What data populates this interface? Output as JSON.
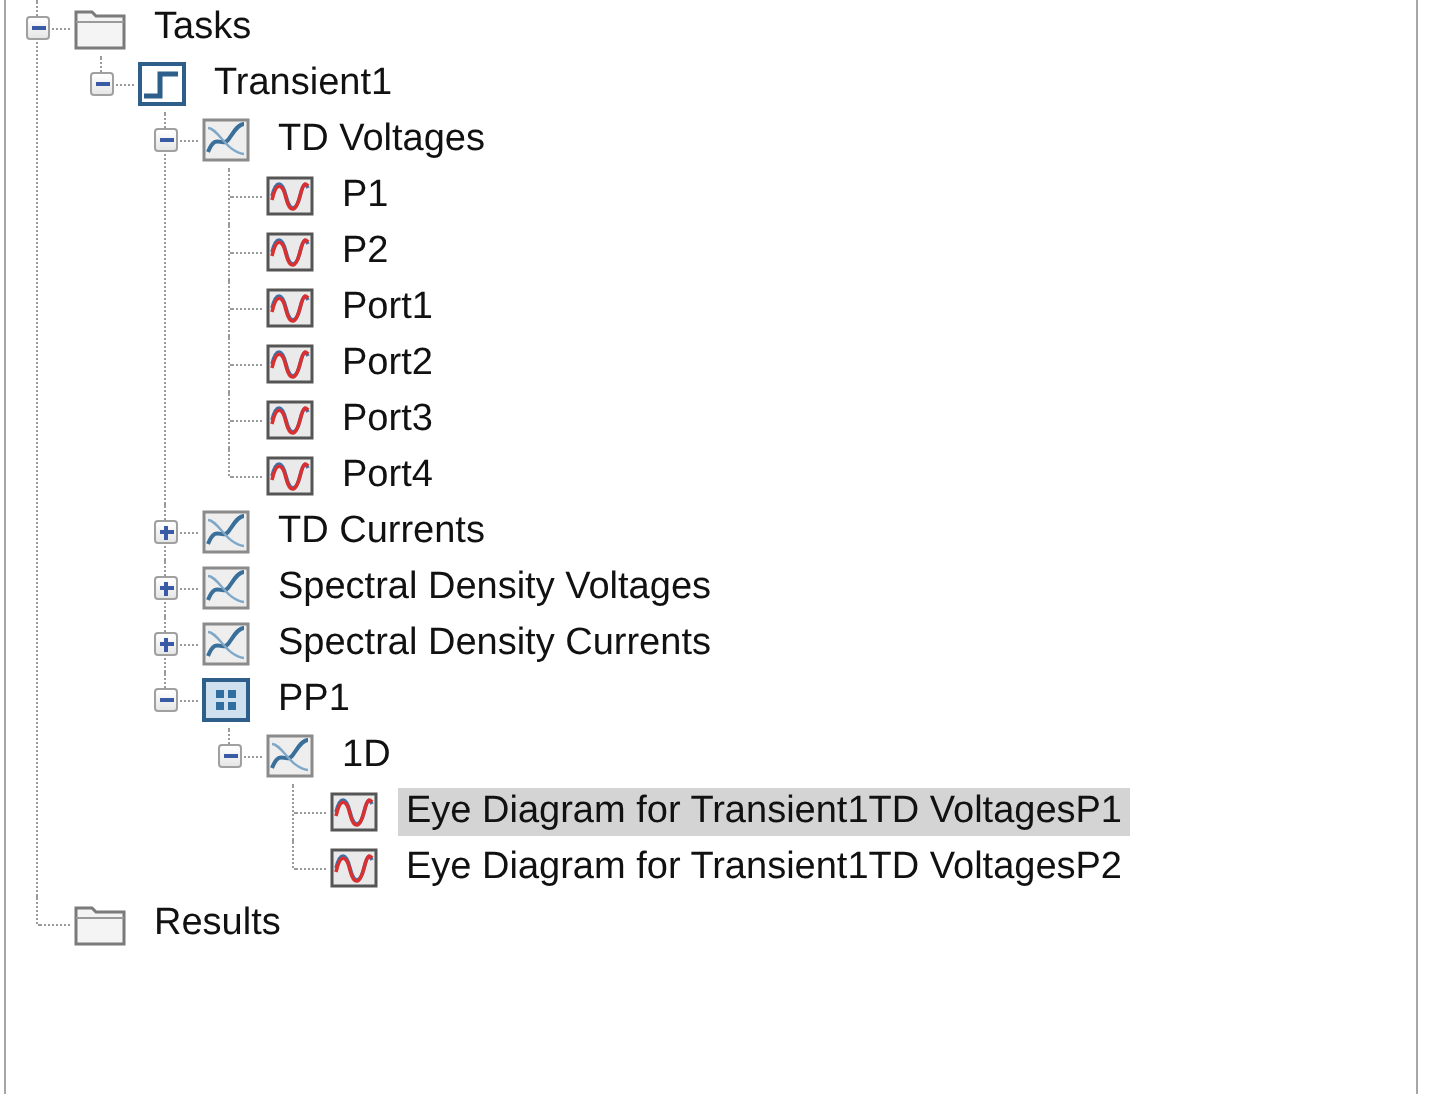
{
  "tree": [
    {
      "label": "Tasks",
      "kind": "folder",
      "expanded": true,
      "selected": false,
      "children": [
        {
          "label": "Transient1",
          "kind": "task",
          "expanded": true,
          "selected": false,
          "children": [
            {
              "label": "TD Voltages",
              "kind": "result-group",
              "expanded": true,
              "selected": false,
              "children": [
                {
                  "label": "P1",
                  "kind": "result",
                  "selected": false
                },
                {
                  "label": "P2",
                  "kind": "result",
                  "selected": false
                },
                {
                  "label": "Port1",
                  "kind": "result",
                  "selected": false
                },
                {
                  "label": "Port2",
                  "kind": "result",
                  "selected": false
                },
                {
                  "label": "Port3",
                  "kind": "result",
                  "selected": false
                },
                {
                  "label": "Port4",
                  "kind": "result",
                  "selected": false
                }
              ]
            },
            {
              "label": "TD Currents",
              "kind": "result-group",
              "expanded": false,
              "selected": false
            },
            {
              "label": "Spectral Density Voltages",
              "kind": "result-group",
              "expanded": false,
              "selected": false
            },
            {
              "label": "Spectral Density Currents",
              "kind": "result-group",
              "expanded": false,
              "selected": false
            },
            {
              "label": "PP1",
              "kind": "postprocessing",
              "expanded": true,
              "selected": false,
              "children": [
                {
                  "label": "1D",
                  "kind": "result-group",
                  "expanded": true,
                  "selected": false,
                  "children": [
                    {
                      "label": "Eye Diagram for Transient1TD VoltagesP1",
                      "kind": "result",
                      "selected": true
                    },
                    {
                      "label": "Eye Diagram for Transient1TD VoltagesP2",
                      "kind": "result",
                      "selected": false
                    }
                  ]
                }
              ]
            }
          ]
        }
      ]
    },
    {
      "label": "Results",
      "kind": "folder",
      "selected": false
    }
  ]
}
